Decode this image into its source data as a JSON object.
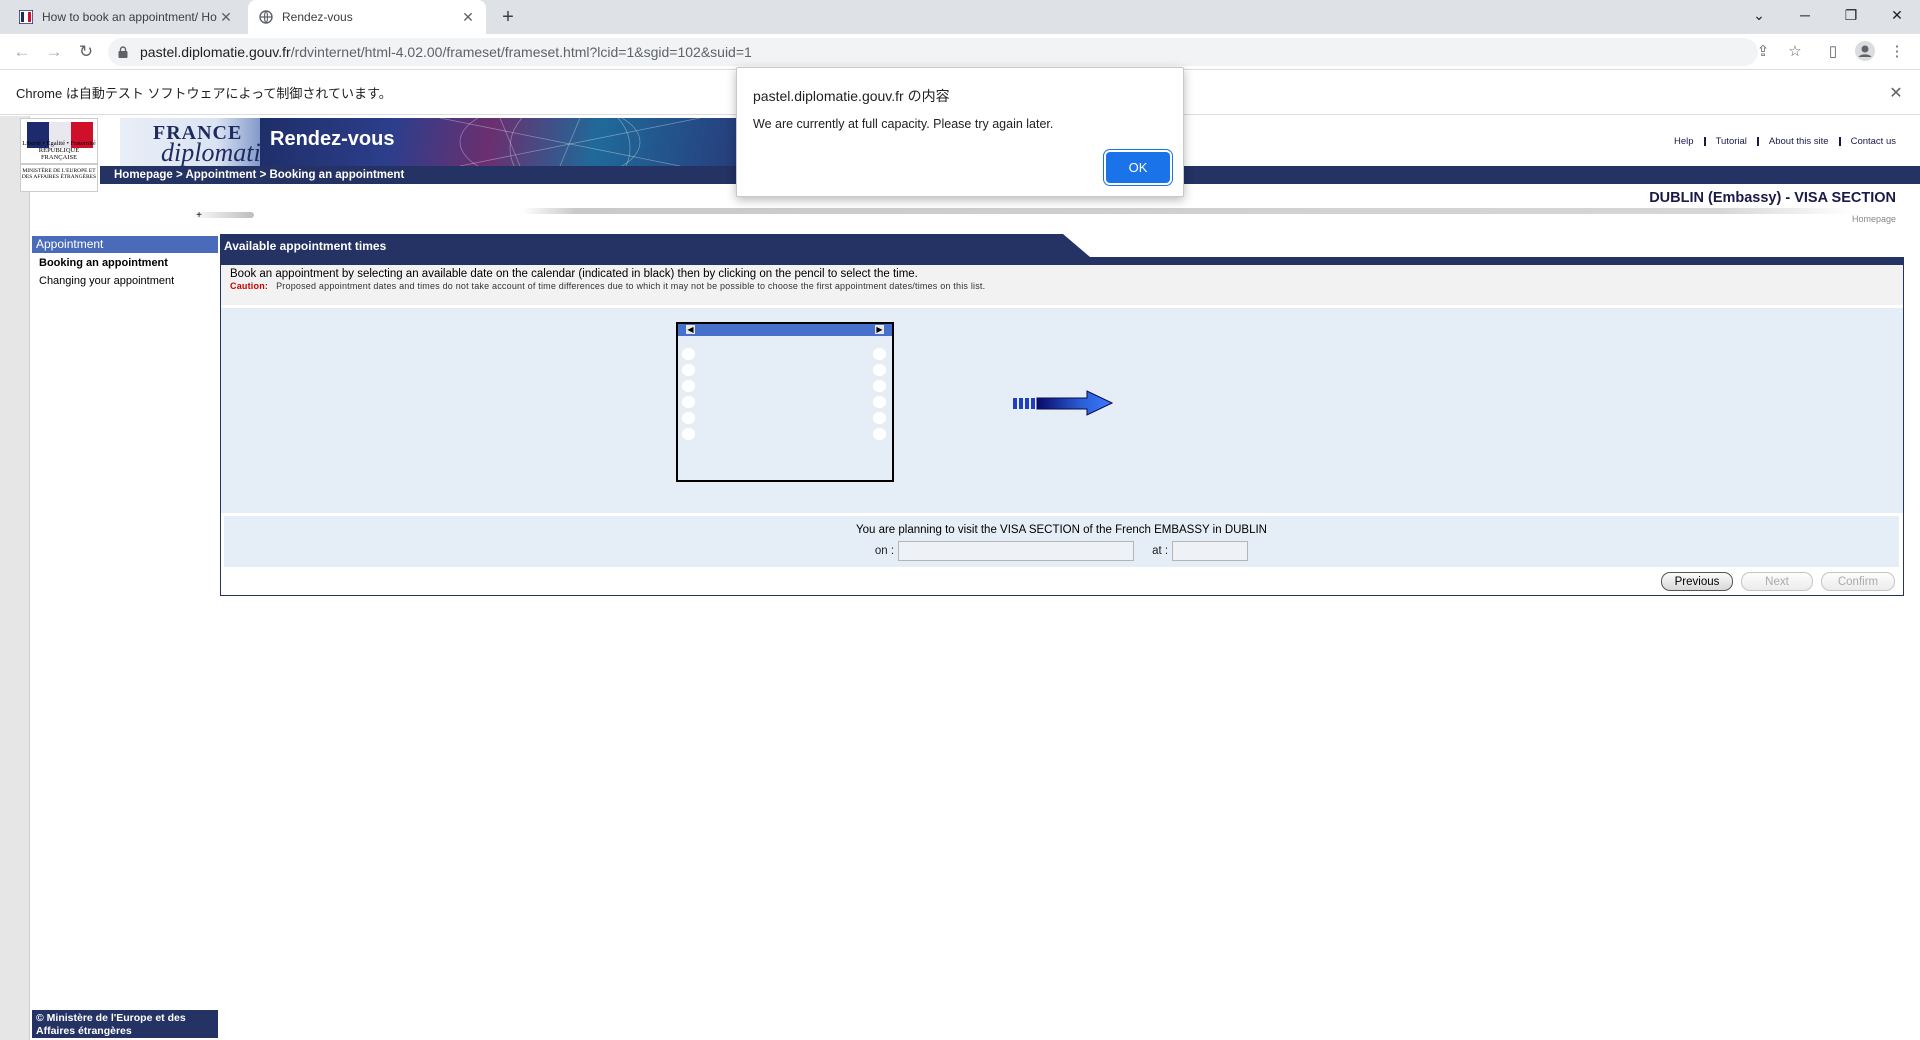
{
  "browser": {
    "tabs": [
      {
        "title": "How to book an appointment/ Ho",
        "active": false
      },
      {
        "title": "Rendez-vous",
        "active": true
      }
    ],
    "url_domain": "pastel.diplomatie.gouv.fr",
    "url_path": "/rdvinternet/html-4.02.00/frameset/frameset.html?lcid=1&sgid=102&suid=1",
    "automation_notice": "Chrome は自動テスト ソフトウェアによって制御されています。"
  },
  "header": {
    "logo_france": "FRANCE",
    "logo_diplomatie": "diplomatie",
    "site_title": "Rendez-vous",
    "republique_motto": "Liberté • Égalité • Fraternité",
    "republique": "RÉPUBLIQUE FRANÇAISE",
    "ministry": "MINISTÈRE DE L'EUROPE ET DES AFFAIRES ÉTRANGÈRES",
    "top_links": [
      "Help",
      "Tutorial",
      "About this site",
      "Contact us"
    ],
    "breadcrumb": "Homepage > Appointment > Booking an appointment",
    "embassy": "DUBLIN (Embassy) - VISA SECTION",
    "homepage_link": "Homepage",
    "plus": "+"
  },
  "sidebar": {
    "heading": "Appointment",
    "items": [
      {
        "label": "Booking an appointment",
        "active": true
      },
      {
        "label": "Changing your appointment",
        "active": false
      }
    ],
    "footer": "© Ministère de l'Europe et des Affaires étrangères"
  },
  "main": {
    "tab_label": "Available appointment times",
    "instruction": "Book an appointment by selecting an available date on the calendar (indicated in black) then by clicking on the pencil to select the time.",
    "caution_label": "Caution:",
    "caution_text": "Proposed appointment dates and times do not take account of time differences due to which it may not be possible to choose the first appointment dates/times on this list.",
    "visit_text": "You are planning to visit the VISA SECTION of the French EMBASSY in DUBLIN",
    "on_label": "on :",
    "on_value": "",
    "at_label": "at :",
    "at_value": "",
    "buttons": {
      "previous": "Previous",
      "next": "Next",
      "confirm": "Confirm"
    }
  },
  "dialog": {
    "title": "pastel.diplomatie.gouv.fr の内容",
    "message": "We are currently at full capacity. Please try again later.",
    "ok": "OK"
  },
  "colors": {
    "navy": "#243264",
    "menu_blue": "#4a6bb9",
    "calendar_bg": "#e5eef7",
    "chrome_blue": "#1a73e8"
  }
}
